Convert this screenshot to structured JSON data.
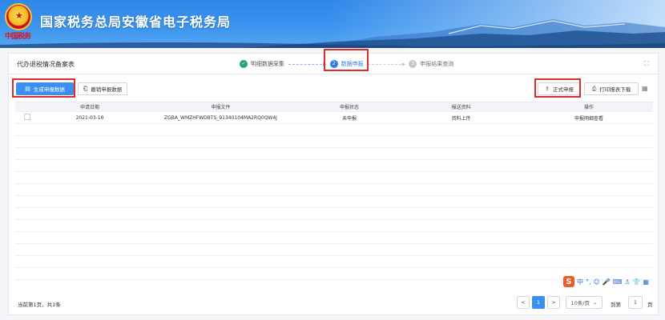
{
  "header": {
    "site_title": "国家税务总局安徽省电子税务局",
    "emblem_caption": "中国税务"
  },
  "card": {
    "title": "代办退税情况备案表"
  },
  "steps": [
    {
      "num": "✓",
      "label": "明细数据采集",
      "state": "done"
    },
    {
      "num": "2",
      "label": "数据申报",
      "state": "active"
    },
    {
      "num": "3",
      "label": "申报结果查询",
      "state": "todo"
    }
  ],
  "toolbar": {
    "generate_label": "生成申报数据",
    "revoke_label": "撤销申报数据",
    "submit_label": "正式申报",
    "print_label": "打印报表下载"
  },
  "table": {
    "columns": [
      "申请日期",
      "申报文件",
      "申报状态",
      "报送资料",
      "操作"
    ],
    "rows": [
      {
        "date": "2021-03-10",
        "file": "ZGBA_WMZHFWDBTS_91340104MA2RQ0QW4J",
        "status": "未申报",
        "material": "资料上传",
        "action": "申报明细查看"
      }
    ]
  },
  "pagination": {
    "summary": "当前第1页，共1条",
    "prev": "<",
    "current": "1",
    "next": ">",
    "page_size": "10条/页",
    "goto_label": "到第",
    "goto_value": "1",
    "page_unit": "页"
  },
  "ime": {
    "logo": "S",
    "chars": [
      "中",
      "°,",
      "☺",
      "🎤",
      "⌨",
      "♙",
      "👕",
      "▦"
    ]
  },
  "colors": {
    "primary": "#3b8ff0",
    "highlight": "#e12a2a",
    "done": "#1aaa6b"
  }
}
